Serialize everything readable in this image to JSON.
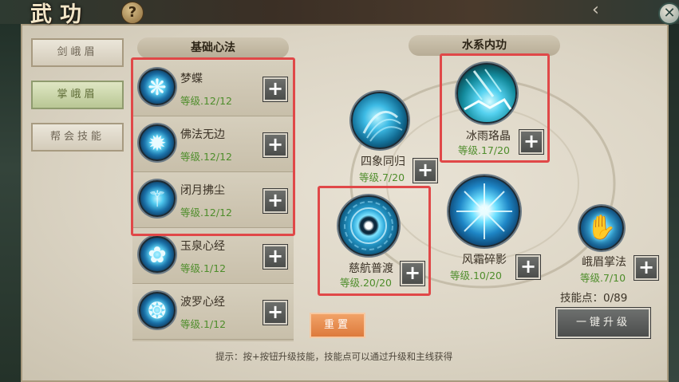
{
  "window": {
    "title": "武功",
    "help_label": "?",
    "close_label": "✕",
    "nav_arrow": "‹"
  },
  "tabs": [
    {
      "label": "剑峨眉",
      "active": false
    },
    {
      "label": "掌峨眉",
      "active": true
    },
    {
      "label": "帮会技能",
      "active": false
    }
  ],
  "basic": {
    "header": "基础心法",
    "skills": [
      {
        "name": "梦蝶",
        "level": "等级.12/12",
        "icon": "butterfly-icon",
        "glyph": "❋"
      },
      {
        "name": "佛法无边",
        "level": "等级.12/12",
        "icon": "lotus-flame-icon",
        "glyph": "✹"
      },
      {
        "name": "闭月拂尘",
        "level": "等级.12/12",
        "icon": "whisk-icon",
        "glyph": "⚚"
      },
      {
        "name": "玉泉心经",
        "level": "等级.1/12",
        "icon": "flower-icon",
        "glyph": "✿"
      },
      {
        "name": "波罗心经",
        "level": "等级.1/12",
        "icon": "mandala-icon",
        "glyph": "❂"
      }
    ]
  },
  "water": {
    "header": "水系内功",
    "skills": [
      {
        "name": "四象同归",
        "level": "等级.7/20",
        "icon": "water-swirl-icon"
      },
      {
        "name": "冰雨珞晶",
        "level": "等级.17/20",
        "icon": "ice-rain-icon"
      },
      {
        "name": "慈航普渡",
        "level": "等级.20/20",
        "icon": "ripple-ring-icon"
      },
      {
        "name": "风霜碎影",
        "level": "等级.10/20",
        "icon": "frost-burst-icon"
      },
      {
        "name": "峨眉掌法",
        "level": "等级.7/10",
        "icon": "palm-icon"
      }
    ]
  },
  "plus_label": "+",
  "skill_points": "技能点：0/89",
  "reset_label": "重置",
  "upgrade_label": "一键升级",
  "hint": "提示：按+按钮升级技能，技能点可以通过升级和主线获得",
  "colors": {
    "level_green": "#4e8d2b",
    "highlight_red": "#e04848",
    "reset_orange": "#e88a4c"
  }
}
